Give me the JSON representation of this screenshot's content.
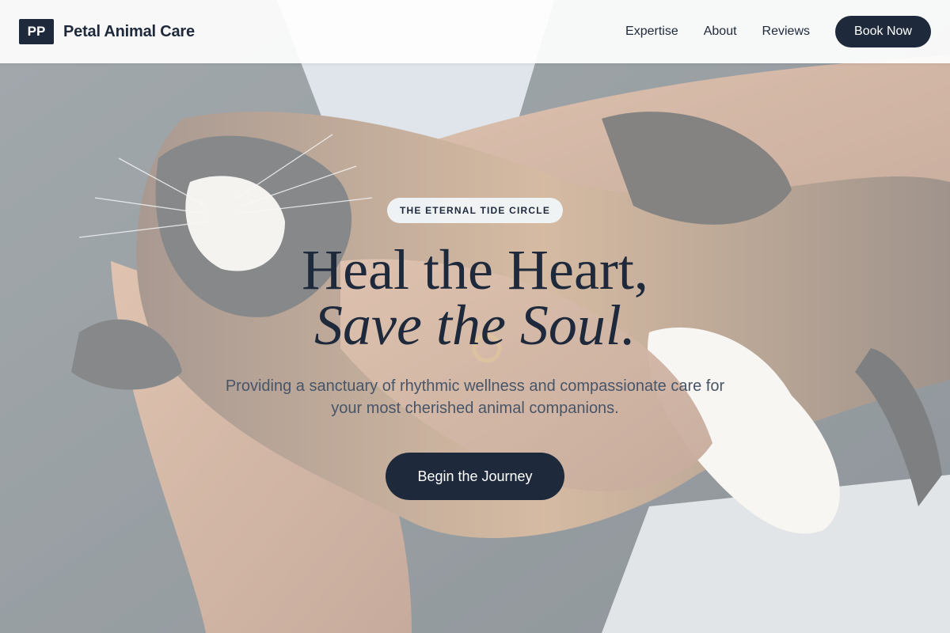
{
  "brand": {
    "initials": "PP",
    "name": "Petal Animal Care"
  },
  "nav": {
    "links": [
      "Expertise",
      "About",
      "Reviews"
    ],
    "book_label": "Book Now"
  },
  "hero": {
    "eyebrow": "THE ETERNAL TIDE CIRCLE",
    "headline_line1": "Heal the Heart,",
    "headline_line2": "Save the Soul.",
    "subtitle": "Providing a sanctuary of rhythmic wellness and compassionate care for your most cherished animal companions.",
    "cta_label": "Begin the Journey",
    "background_image": "calico-cat-held-in-arms"
  },
  "colors": {
    "primary": "#1e293b",
    "text_muted": "#475569",
    "header_bg": "#ffffff"
  }
}
